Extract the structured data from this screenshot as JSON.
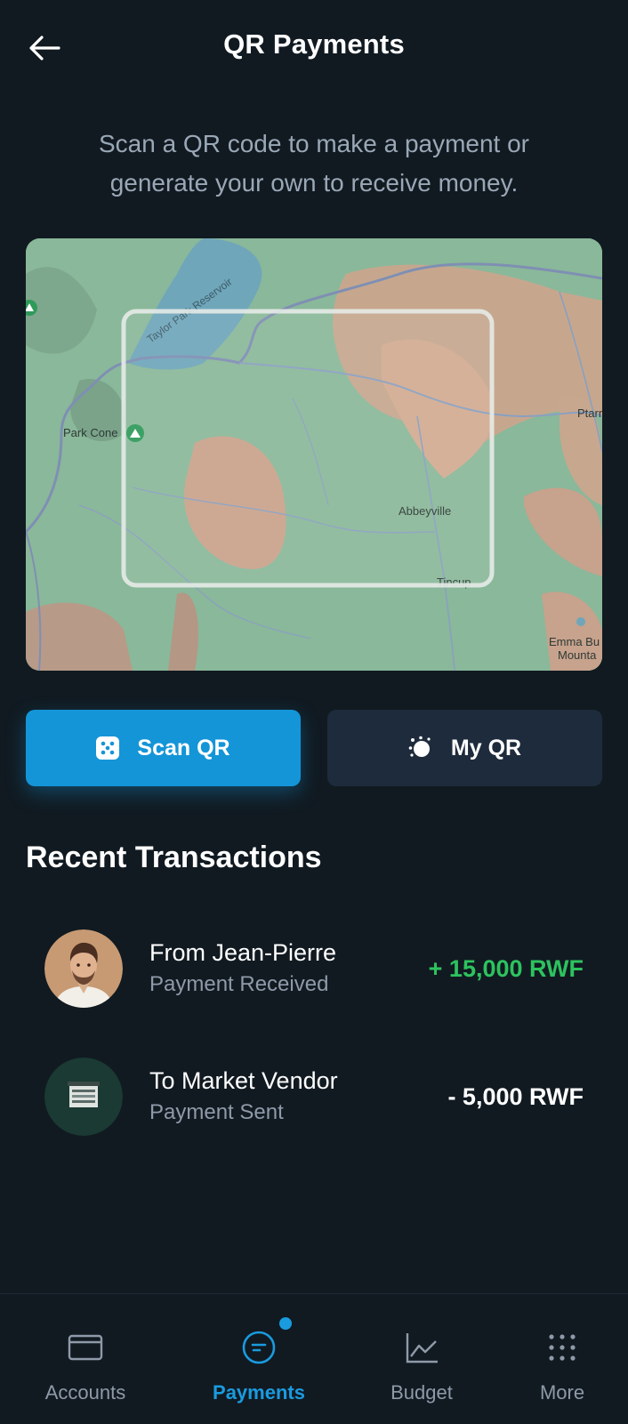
{
  "header": {
    "title": "QR Payments",
    "back_icon": "arrow-left-icon"
  },
  "subtitle": "Scan a QR code to make a payment or generate your own to receive money.",
  "map": {
    "labels": {
      "reservoir": "Taylor Park Reservoir",
      "park_cone": "Park Cone",
      "abbeyville": "Abbeyville",
      "tincup": "Tincup",
      "ptarm": "Ptarm",
      "emma1": "Emma Bu",
      "emma2": "Mounta"
    }
  },
  "actions": {
    "scan_label": "Scan QR",
    "scan_icon": "qr-scan-icon",
    "myqr_label": "My QR",
    "myqr_icon": "qr-code-icon"
  },
  "transactions": {
    "title": "Recent Transactions",
    "items": [
      {
        "name": "From Jean-Pierre",
        "type": "Payment Received",
        "amount": "+ 15,000 RWF",
        "avatar": "person-avatar"
      },
      {
        "name": "To Market Vendor",
        "type": "Payment Sent",
        "amount": "- 5,000 RWF",
        "avatar": "shop-icon"
      }
    ]
  },
  "nav": {
    "items": [
      {
        "label": "Accounts",
        "icon": "card-icon"
      },
      {
        "label": "Payments",
        "icon": "payments-icon"
      },
      {
        "label": "Budget",
        "icon": "chart-icon"
      },
      {
        "label": "More",
        "icon": "grid-dots-icon"
      }
    ],
    "active": "Payments"
  },
  "colors": {
    "background": "#111a21",
    "accent": "#1495d8",
    "positive": "#2dc35e",
    "secondary_button": "#1e2b3c"
  }
}
